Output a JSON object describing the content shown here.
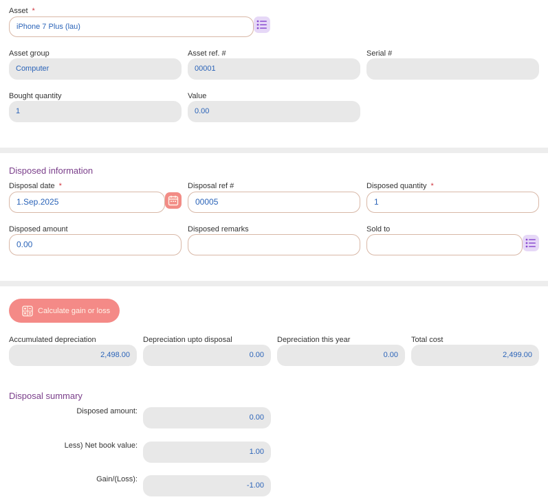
{
  "asset": {
    "label": "Asset",
    "required_mark": "*",
    "value": "iPhone 7 Plus (lau)",
    "list_icon": "list-icon"
  },
  "asset_info": {
    "asset_group": {
      "label": "Asset group",
      "value": "Computer"
    },
    "asset_ref": {
      "label": "Asset ref. #",
      "value": "00001"
    },
    "serial": {
      "label": "Serial #",
      "value": ""
    },
    "bought_quantity": {
      "label": "Bought quantity",
      "value": "1"
    },
    "value": {
      "label": "Value",
      "value": "0.00"
    }
  },
  "disposed_information": {
    "title": "Disposed information",
    "disposal_date": {
      "label": "Disposal date",
      "required_mark": "*",
      "value": "1.Sep.2025",
      "icon": "calendar-icon"
    },
    "disposal_ref": {
      "label": "Disposal ref #",
      "value": "00005"
    },
    "disposed_quantity": {
      "label": "Disposed quantity",
      "required_mark": "*",
      "value": "1"
    },
    "disposed_amount": {
      "label": "Disposed amount",
      "value": "0.00"
    },
    "disposed_remarks": {
      "label": "Disposed remarks",
      "value": ""
    },
    "sold_to": {
      "label": "Sold to",
      "value": "",
      "icon": "list-icon"
    }
  },
  "calculation": {
    "button_label": "Calculate gain or loss",
    "button_icon": "calculator-icon",
    "accumulated_depreciation": {
      "label": "Accumulated depreciation",
      "value": "2,498.00"
    },
    "depreciation_upto_disposal": {
      "label": "Depreciation upto disposal",
      "value": "0.00"
    },
    "depreciation_this_year": {
      "label": "Depreciation this year",
      "value": "0.00"
    },
    "total_cost": {
      "label": "Total cost",
      "value": "2,499.00"
    }
  },
  "disposal_summary": {
    "title": "Disposal summary",
    "disposed_amount": {
      "label": "Disposed amount:",
      "value": "0.00"
    },
    "net_book_value": {
      "label": "Less) Net book value:",
      "value": "1.00"
    },
    "gain_loss": {
      "label": "Gain/(Loss):",
      "value": "-1.00"
    }
  },
  "colors": {
    "accent_purple": "#7a3e8a",
    "value_blue": "#2a63b8",
    "button_red": "#f48a87",
    "required_red": "#d0353e"
  }
}
